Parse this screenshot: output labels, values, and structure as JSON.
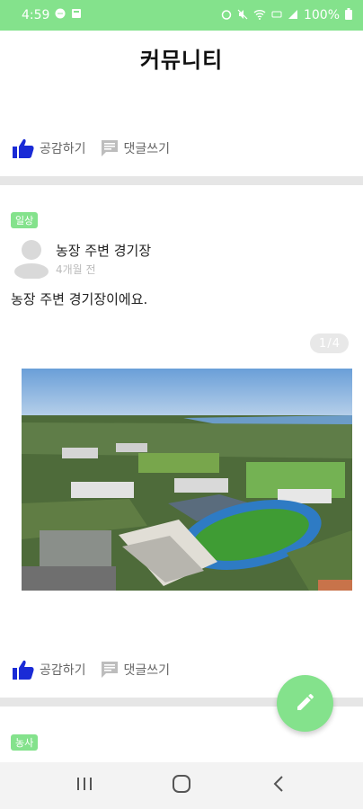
{
  "status_bar": {
    "time": "4:59",
    "battery": "100%",
    "bg_color": "#84e28c"
  },
  "header": {
    "title": "커뮤니티"
  },
  "actions": {
    "like_label": "공감하기",
    "comment_label": "댓글쓰기",
    "like_color": "#1a2bd6"
  },
  "posts": [
    {
      "category": "일상",
      "author": "농장 주변 경기장",
      "time": "4개월 전",
      "body": "농장 주변 경기장이에요.",
      "image_index": "1",
      "image_count": "4"
    },
    {
      "category": "농사"
    }
  ],
  "icons": {
    "like": "thumbs-up-icon",
    "comment": "comment-icon",
    "fab": "pencil-icon",
    "nav_recent": "recent-apps-icon",
    "nav_home": "home-icon",
    "nav_back": "back-icon"
  },
  "colors": {
    "accent": "#84e28c",
    "divider": "#e6e6e6"
  }
}
